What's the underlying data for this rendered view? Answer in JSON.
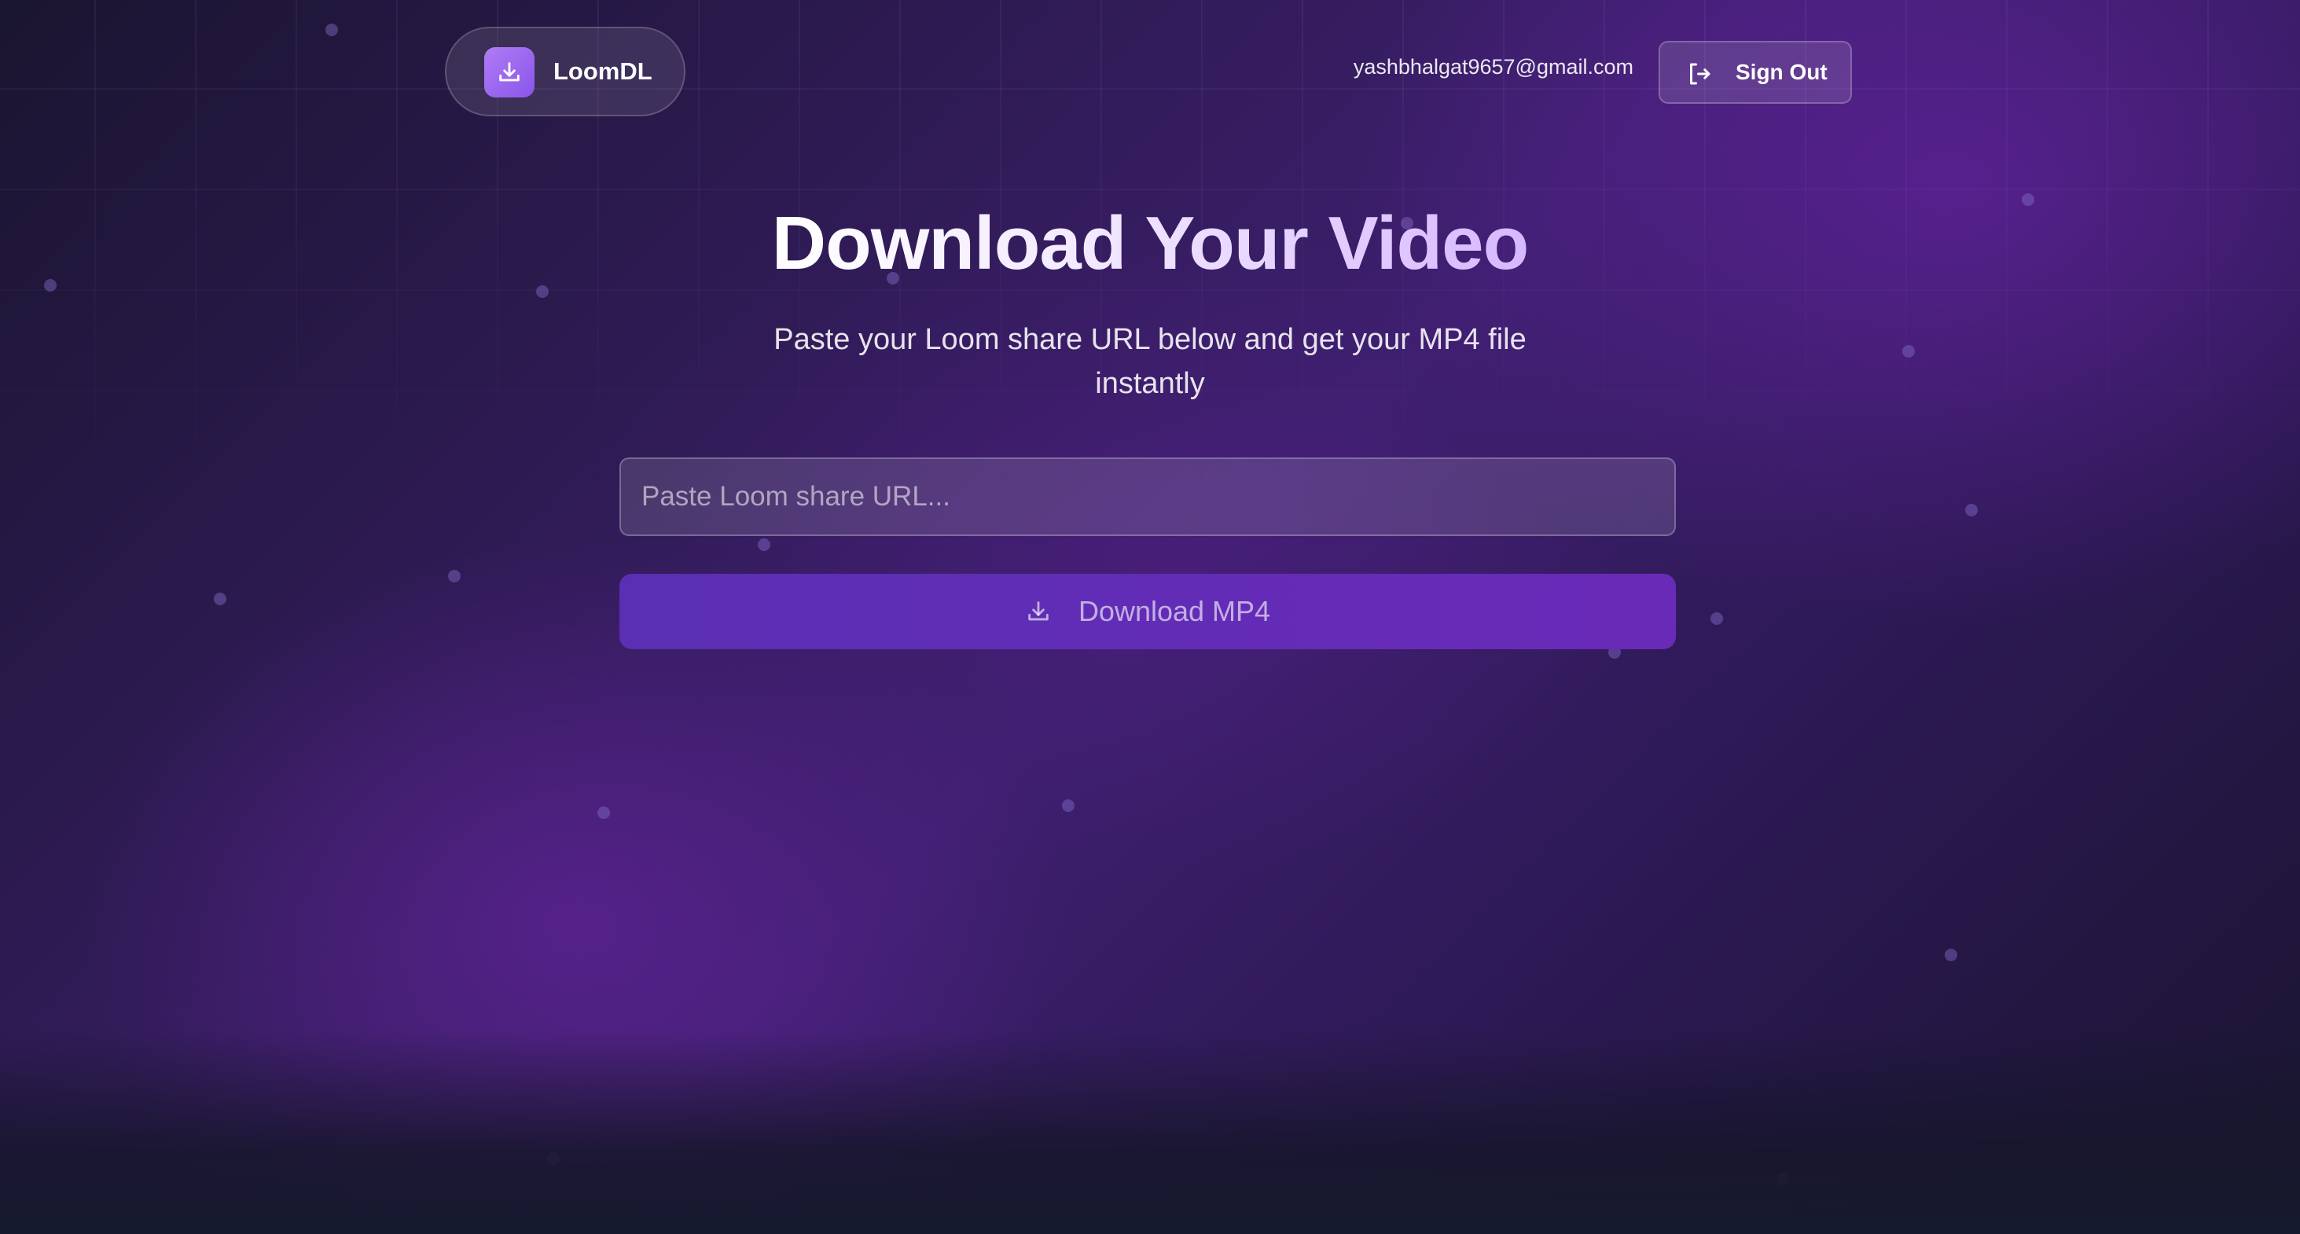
{
  "header": {
    "logo_text": "LoomDL",
    "logo_icon": "download-icon",
    "user_email": "yashbhalgat9657@gmail.com",
    "sign_out_label": "Sign Out",
    "sign_out_icon": "sign-out-icon"
  },
  "hero": {
    "title": "Download Your Video",
    "subtitle": "Paste your Loom share URL below and get your MP4 file instantly"
  },
  "form": {
    "url_value": "",
    "url_placeholder": "Paste Loom share URL...",
    "download_label": "Download MP4",
    "download_icon": "download-icon"
  },
  "colors": {
    "accent": "#8a55ea",
    "button": "#5f2db6",
    "background_dark": "#1a1530",
    "background_purple": "#4a1f80"
  }
}
